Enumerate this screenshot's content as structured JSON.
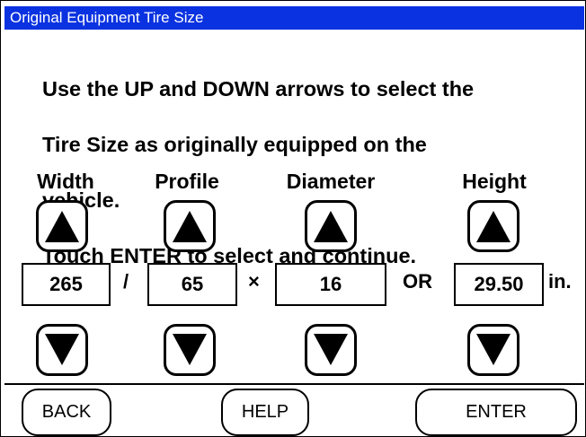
{
  "window": {
    "title": "Original Equipment Tire Size"
  },
  "instructions": {
    "line1": "Use the UP and DOWN arrows to select the",
    "line2": "Tire Size as originally equipped on the",
    "line3": "vehicle.",
    "line4": "Touch ENTER to select and continue."
  },
  "columns": {
    "width_label": "Width",
    "profile_label": "Profile",
    "diameter_label": "Diameter",
    "height_label": "Height"
  },
  "values": {
    "width": "265",
    "profile": "65",
    "diameter": "16",
    "height": "29.50"
  },
  "separators": {
    "slash": "/",
    "times": "×",
    "or": "OR",
    "unit": "in."
  },
  "buttons": {
    "back": "BACK",
    "help": "HELP",
    "enter": "ENTER"
  },
  "icons": {
    "up": "triangle-up-icon",
    "down": "triangle-down-icon"
  }
}
